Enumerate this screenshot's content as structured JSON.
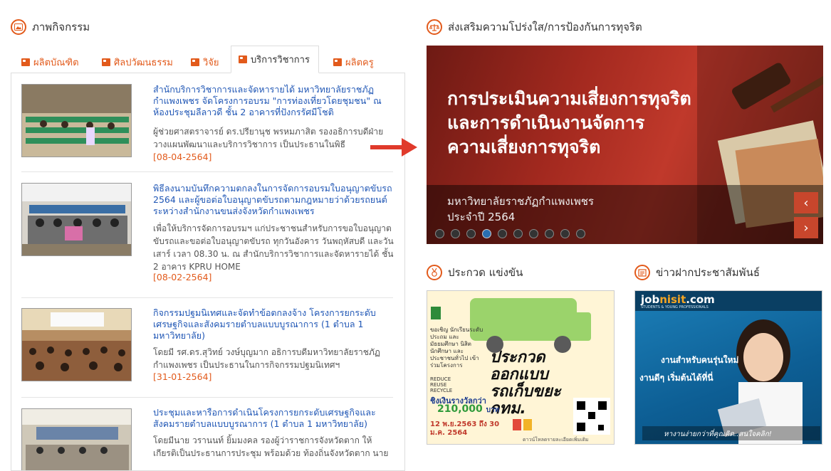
{
  "left_section": {
    "title": "ภาพกิจกรรม",
    "icon": "photo-icon"
  },
  "tabs": [
    {
      "label": "ผลิตบัณฑิต"
    },
    {
      "label": "ศิลปวัฒนธรรม"
    },
    {
      "label": "วิจัย"
    },
    {
      "label": "บริการวิชาการ"
    },
    {
      "label": "ผลิตครู"
    }
  ],
  "active_tab": "บริการวิชาการ",
  "news": [
    {
      "title": "สำนักบริการวิชาการและจัดหารายได้ มหาวิทยาลัยราชภัฏกำแพงเพชร จัดโครงการอบรม \"การท่องเที่ยวโดยชุมชน\" ณ ห้องประชุมลีลาวดี ชั้น 2 อาคารที่ปังกรรัศมีโชติ",
      "desc": "ผู้ช่วยศาสตราจารย์ ดร.ปรียานุช พรหมภาสิต รองอธิการบดีฝ่ายวางแผนพัฒนาและบริการวิชาการ เป็นประธานในพิธี",
      "date": "[08-04-2564]"
    },
    {
      "title": "พิธีลงนามบันทึกความตกลงในการจัดการอบรมใบอนุญาตขับรถ 2564 และผู้ขอต่อใบอนุญาตขับรถตามกฎหมายว่าด้วยรถยนต์ระหว่างสำนักงานขนส่งจังหวัดกำแพงเพชร",
      "desc": "เพื่อให้บริการจัดการอบรมฯ แก่ประชาชนสำหรับการขอใบอนุญาตขับรถและขอต่อใบอนุญาตขับรถ ทุกวันอังคาร วันพฤหัสบดี และวันเสาร์ เวลา 08.30 น. ณ สำนักบริการวิชาการและจัดหารายได้ ชั้น 2 อาคาร KPRU HOME",
      "date": "[08-02-2564]"
    },
    {
      "title": "กิจกรรมปฐมนิเทศและจัดทำข้อตกลงจ้าง โครงการยกระดับเศรษฐกิจและสังคมรายตำบลแบบบูรณาการ (1 ตำบล 1 มหาวิทยาลัย)",
      "desc": "โดยมี รศ.ดร.สุวิทย์ วงษ์บุญมาก อธิการบดีมหาวิทยาลัยราชภัฏกำแพงเพชร เป็นประธานในการกิจกรรมปฐมนิเทศฯ",
      "date": "[31-01-2564]"
    },
    {
      "title": "ประชุมและหารือการดำเนินโครงการยกระดับเศรษฐกิจและสังคมรายตำบลแบบบูรณาการ (1 ตำบล 1 มหาวิทยาลัย)",
      "desc": "โดยมีนาย วรานนท์ ยิ้มมงคล รองผู้ว่าราชการจังหวัดตาก ให้เกียรติเป็นประธานการประชุม พร้อมด้วย ท้องถิ่นจังหวัดตาก นาย",
      "date": ""
    }
  ],
  "right_section": {
    "title": "ส่งเสริมความโปร่งใส/การป้องกันการทุจริต",
    "icon": "scales-icon"
  },
  "banner": {
    "title_lines": [
      "การประเมินความเสี่ยงการทุจริต",
      "และการดำเนินงานจัดการ",
      "ความเสี่ยงการทุจริต"
    ],
    "subtitle_lines": [
      "มหาวิทยาลัยราชภัฏกำแพงเพชร",
      "ประจำปี 2564"
    ],
    "slide_count": 10,
    "active_slide": 4,
    "prev_symbol": "‹",
    "next_symbol": "›"
  },
  "contest_section": {
    "title": "ประกวด แข่งขัน",
    "icon": "medal-icon"
  },
  "contest_poster": {
    "invite": "ขอเชิญ นักเรียนระดับประถม และมัธยมศึกษา นิสิต นักศึกษา และประชาชนทั่วไป เข้าร่วมโครงการ",
    "headline": "ประกวด ออกแบบ รถเก็บขยะ กทม.",
    "reduce": "REDUCE",
    "reuse": "REUSE",
    "recycle": "RECYCLE",
    "prize_label": "ชิงเงินรางวัลกว่า",
    "prize_amount": "210,000",
    "prize_unit": "บาท",
    "date_range": "12 พ.ย.2563 ถึง 30 ม.ค. 2564",
    "footer": "ดาวน์โหลดรายละเอียดเพิ่มเติม"
  },
  "pr_section": {
    "title": "ข่าวฝากประชาสัมพันธ์",
    "icon": "newspaper-icon"
  },
  "job_ad": {
    "brand_prefix": "job",
    "brand_highlight": "nisit",
    "brand_suffix": ".com",
    "tagline": "STUDENTS & YOUNG PROFESSIONALS",
    "line1": "งานสำหรับคนรุ่นใหม่",
    "line2": "งานดีๆ เริ่มต้นได้ที่นี่",
    "bottom": "หางานง่ายกว่าที่คุณคิด..สนใจคลิก!"
  },
  "colors": {
    "accent": "#e25a1b",
    "link": "#1f56b5",
    "banner_red": "#a3291f"
  }
}
